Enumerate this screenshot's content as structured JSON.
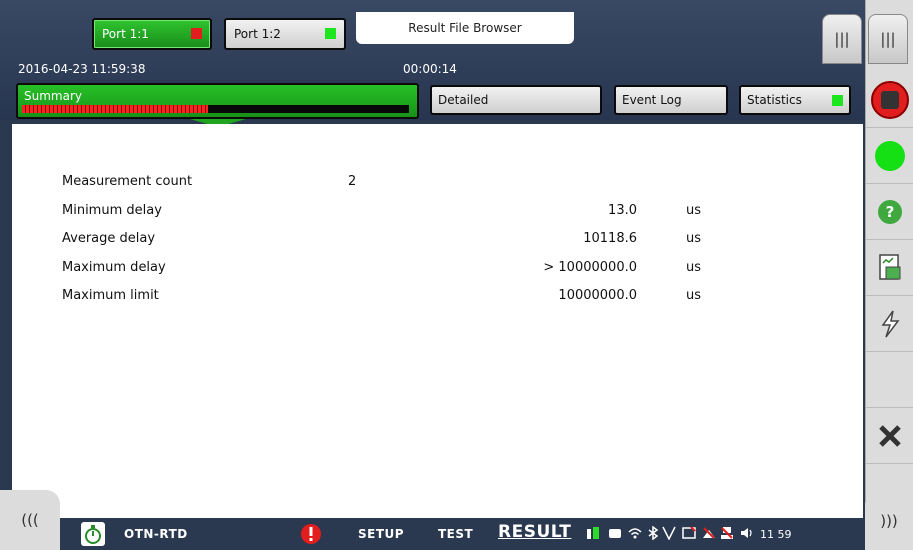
{
  "ports": {
    "port1": {
      "label": "Port 1:1",
      "status_color": "#e21d1d"
    },
    "port2": {
      "label": "Port 1:2",
      "status_color": "#1ee61e"
    }
  },
  "file_browser_label": "Result File Browser",
  "datetime": "2016-04-23 11:59:38",
  "elapsed": "00:00:14",
  "tabs": {
    "summary": "Summary",
    "detailed": "Detailed",
    "event_log": "Event Log",
    "statistics": "Statistics"
  },
  "summary_progress": 0.48,
  "results": [
    {
      "label": "Measurement count",
      "value": "2",
      "unit": ""
    },
    {
      "label": "Minimum delay",
      "value": "13.0",
      "unit": "us"
    },
    {
      "label": "Average delay",
      "value": "10118.6",
      "unit": "us"
    },
    {
      "label": "Maximum delay",
      "value": "> 10000000.0",
      "unit": "us"
    },
    {
      "label": "Maximum limit",
      "value": "10000000.0",
      "unit": "us"
    }
  ],
  "bottom": {
    "app_name": "OTN-RTD",
    "setup": "SETUP",
    "test": "TEST",
    "result": "RESULT",
    "clock": "11 59"
  },
  "right_icons": [
    "menu-icon",
    "stop-icon",
    "green-status-icon",
    "help-icon",
    "report-icon",
    "lightning-icon",
    "close-icon"
  ]
}
